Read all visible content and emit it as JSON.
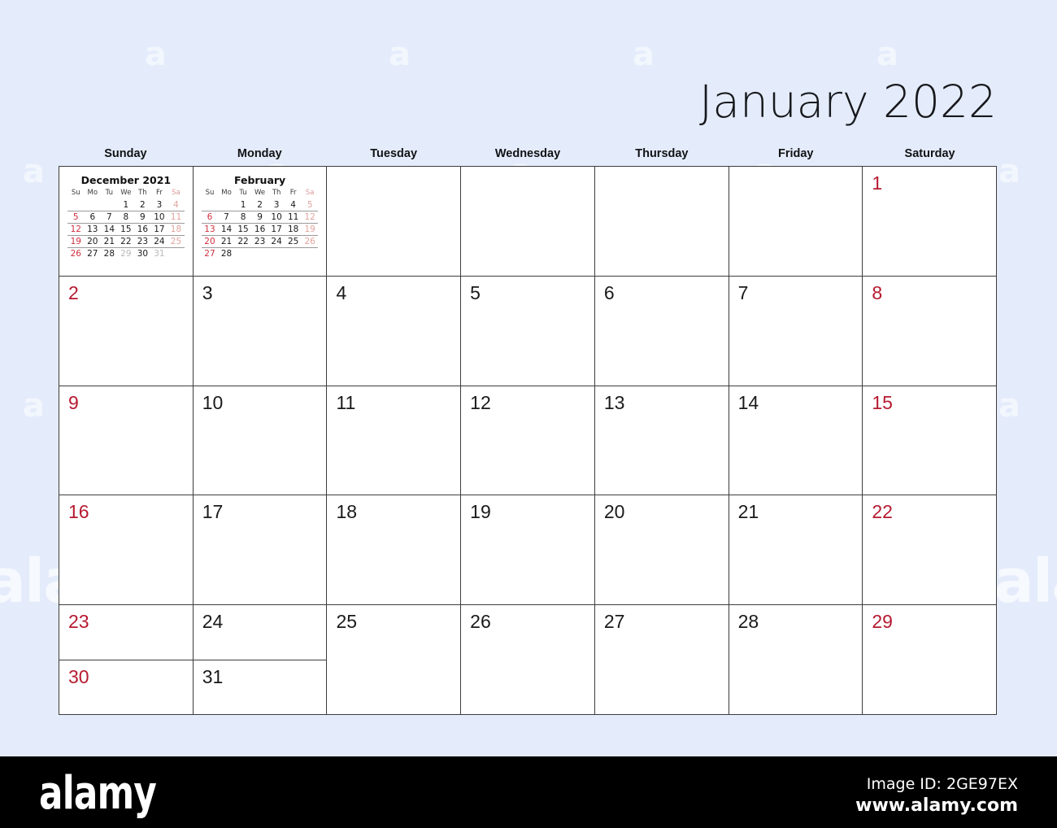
{
  "background_color": "#e4ecfb",
  "accent_weekend_color": "#b61a30",
  "grid_line_color": "#3c3c3c",
  "header": {
    "month_title": "January 2022"
  },
  "weekday_headers": [
    "Sunday",
    "Monday",
    "Tuesday",
    "Wednesday",
    "Thursday",
    "Friday",
    "Saturday"
  ],
  "mini_calendars": [
    {
      "title": "December 2021",
      "weekdays": [
        "Su",
        "Mo",
        "Tu",
        "We",
        "Th",
        "Fr",
        "Sa"
      ],
      "weeks": [
        [
          "",
          "",
          "",
          "1",
          "2",
          "3",
          "4"
        ],
        [
          "5",
          "6",
          "7",
          "8",
          "9",
          "10",
          "11"
        ],
        [
          "12",
          "13",
          "14",
          "15",
          "16",
          "17",
          "18"
        ],
        [
          "19",
          "20",
          "21",
          "22",
          "23",
          "24",
          "25"
        ],
        [
          "26",
          "27",
          "28",
          "29",
          "30",
          "31",
          ""
        ]
      ],
      "dim_cells": [
        "29",
        "31"
      ]
    },
    {
      "title": "February",
      "weekdays": [
        "Su",
        "Mo",
        "Tu",
        "We",
        "Th",
        "Fr",
        "Sa"
      ],
      "weeks": [
        [
          "",
          "",
          "1",
          "2",
          "3",
          "4",
          "5"
        ],
        [
          "6",
          "7",
          "8",
          "9",
          "10",
          "11",
          "12"
        ],
        [
          "13",
          "14",
          "15",
          "16",
          "17",
          "18",
          "19"
        ],
        [
          "20",
          "21",
          "22",
          "23",
          "24",
          "25",
          "26"
        ],
        [
          "27",
          "28",
          "",
          "",
          "",
          "",
          ""
        ]
      ],
      "dim_cells": []
    }
  ],
  "weeks": [
    {
      "cells": [
        {
          "day": "",
          "type": "mini",
          "mini_index": 0
        },
        {
          "day": "",
          "type": "mini",
          "mini_index": 1
        },
        {
          "day": "",
          "type": "empty"
        },
        {
          "day": "",
          "type": "empty"
        },
        {
          "day": "",
          "type": "empty"
        },
        {
          "day": "",
          "type": "empty"
        },
        {
          "day": "1",
          "type": "day",
          "weekend": true
        }
      ]
    },
    {
      "cells": [
        {
          "day": "2",
          "type": "day",
          "weekend": true
        },
        {
          "day": "3",
          "type": "day",
          "weekend": false
        },
        {
          "day": "4",
          "type": "day",
          "weekend": false
        },
        {
          "day": "5",
          "type": "day",
          "weekend": false
        },
        {
          "day": "6",
          "type": "day",
          "weekend": false
        },
        {
          "day": "7",
          "type": "day",
          "weekend": false
        },
        {
          "day": "8",
          "type": "day",
          "weekend": true
        }
      ]
    },
    {
      "cells": [
        {
          "day": "9",
          "type": "day",
          "weekend": true
        },
        {
          "day": "10",
          "type": "day",
          "weekend": false
        },
        {
          "day": "11",
          "type": "day",
          "weekend": false
        },
        {
          "day": "12",
          "type": "day",
          "weekend": false
        },
        {
          "day": "13",
          "type": "day",
          "weekend": false
        },
        {
          "day": "14",
          "type": "day",
          "weekend": false
        },
        {
          "day": "15",
          "type": "day",
          "weekend": true
        }
      ]
    },
    {
      "cells": [
        {
          "day": "16",
          "type": "day",
          "weekend": true
        },
        {
          "day": "17",
          "type": "day",
          "weekend": false
        },
        {
          "day": "18",
          "type": "day",
          "weekend": false
        },
        {
          "day": "19",
          "type": "day",
          "weekend": false
        },
        {
          "day": "20",
          "type": "day",
          "weekend": false
        },
        {
          "day": "21",
          "type": "day",
          "weekend": false
        },
        {
          "day": "22",
          "type": "day",
          "weekend": true
        }
      ]
    }
  ],
  "last_row": {
    "sunday_split": [
      {
        "day": "23",
        "weekend": true
      },
      {
        "day": "30",
        "weekend": true
      }
    ],
    "monday_split": [
      {
        "day": "24",
        "weekend": false
      },
      {
        "day": "31",
        "weekend": false
      }
    ],
    "rest": [
      {
        "day": "25",
        "weekend": false
      },
      {
        "day": "26",
        "weekend": false
      },
      {
        "day": "27",
        "weekend": false
      },
      {
        "day": "28",
        "weekend": false
      },
      {
        "day": "29",
        "weekend": true
      }
    ]
  },
  "watermark": {
    "text": "alamy",
    "letter": "a"
  },
  "footer": {
    "logo": "alamy",
    "image_id": "Image ID: 2GE97EX",
    "url": "www.alamy.com"
  }
}
